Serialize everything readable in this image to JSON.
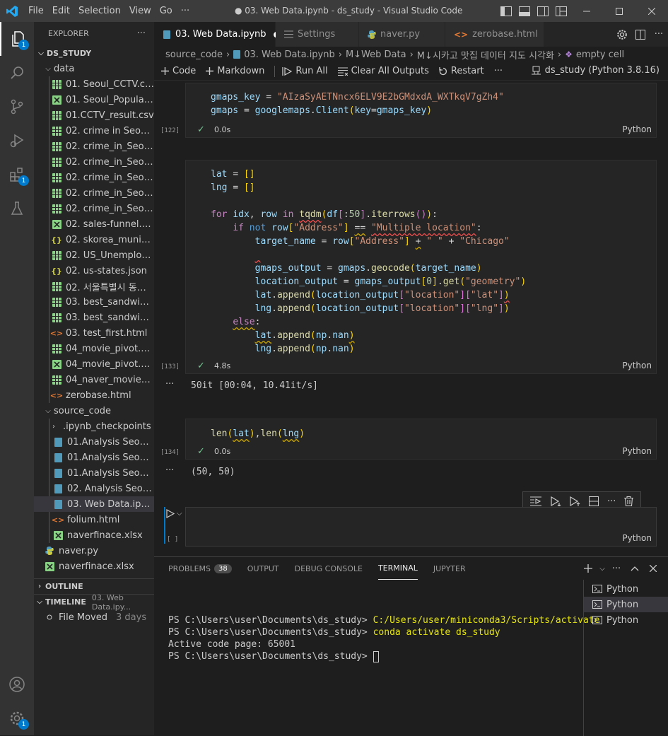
{
  "titlebar": {
    "menu": [
      "File",
      "Edit",
      "Selection",
      "View",
      "Go",
      "···"
    ],
    "title": "● 03. Web Data.ipynb - ds_study - Visual Studio Code"
  },
  "activity": {
    "explorer_badge": "1",
    "extensions_badge": "1",
    "settings_badge": "1"
  },
  "sidebar": {
    "header": "EXPLORER",
    "more": "···",
    "root": "DS_STUDY",
    "data_folder": "data",
    "data_files": [
      {
        "name": "01. Seoul_CCTV.csv",
        "type": "csv"
      },
      {
        "name": "01. Seoul_Populatio...",
        "type": "xlsx"
      },
      {
        "name": "01.CCTV_result.csv",
        "type": "csv"
      },
      {
        "name": "02. crime in Seoul_fi...",
        "type": "csv"
      },
      {
        "name": "02. crime_in_Seoul_1...",
        "type": "csv"
      },
      {
        "name": "02. crime_in_Seoul_fi...",
        "type": "csv"
      },
      {
        "name": "02. crime_in_Seoul_l...",
        "type": "csv"
      },
      {
        "name": "02. crime_in_Seoul_r...",
        "type": "csv"
      },
      {
        "name": "02. crime_in_Seoul.csv",
        "type": "csv"
      },
      {
        "name": "02. sales-funnel.xlsx",
        "type": "xlsx"
      },
      {
        "name": "02. skorea_municipa...",
        "type": "json"
      },
      {
        "name": "02. US_Unemploym...",
        "type": "csv"
      },
      {
        "name": "02. us-states.json",
        "type": "json"
      },
      {
        "name": "02. 서울특별시 동작...",
        "type": "csv"
      },
      {
        "name": "03. best_sandwiches...",
        "type": "csv"
      },
      {
        "name": "03. best_sandwiches...",
        "type": "csv"
      },
      {
        "name": "03. test_first.html",
        "type": "html"
      },
      {
        "name": "04_movie_pivot.csv",
        "type": "csv"
      },
      {
        "name": "04_movie_pivot.xlsx",
        "type": "xlsx"
      },
      {
        "name": "04_naver_movie_raw...",
        "type": "csv"
      },
      {
        "name": "zerobase.html",
        "type": "html"
      }
    ],
    "source_folder": "source_code",
    "source_files": [
      {
        "name": ".ipynb_checkpoints",
        "type": "folder"
      },
      {
        "name": "01.Analysis Seoul CC...",
        "type": "ipynb"
      },
      {
        "name": "01.Analysis Seoul CC...",
        "type": "ipynb"
      },
      {
        "name": "01.Analysis Seoul CC...",
        "type": "ipynb"
      },
      {
        "name": "02. Analysis Seoul Cr...",
        "type": "ipynb"
      },
      {
        "name": "03. Web Data.ipynb",
        "type": "ipynb",
        "selected": true
      },
      {
        "name": "folium.html",
        "type": "html"
      },
      {
        "name": "naverfinace.xlsx",
        "type": "xlsx"
      }
    ],
    "root_files": [
      {
        "name": "naver.py",
        "type": "py"
      },
      {
        "name": "naverfinace.xlsx",
        "type": "xlsx"
      }
    ],
    "outline": "OUTLINE",
    "timeline": "TIMELINE",
    "timeline_file": "03. Web Data.ipy...",
    "timeline_event": "File Moved",
    "timeline_time": "3 days"
  },
  "tabs": [
    {
      "label": "03. Web Data.ipynb",
      "active": true,
      "dirty": "●"
    },
    {
      "label": "Settings"
    },
    {
      "label": "naver.py"
    },
    {
      "label": "zerobase.html"
    }
  ],
  "breadcrumbs": [
    "source_code",
    "03. Web Data.ipynb",
    "M↓Web Data",
    "M↓시카고 맛집 데이터 지도 시각화",
    "empty cell"
  ],
  "toolbar": {
    "code": "Code",
    "markdown": "Markdown",
    "run_all": "Run All",
    "clear": "Clear All Outputs",
    "restart": "Restart",
    "more": "···",
    "kernel": "ds_study (Python 3.8.16)"
  },
  "cells": {
    "c122": {
      "count": "[122]",
      "duration": "0.0s",
      "lang": "Python"
    },
    "c133": {
      "count": "[133]",
      "duration": "4.8s",
      "lang": "Python",
      "output": "50it [00:04, 10.41it/s]"
    },
    "c134": {
      "count": "[134]",
      "duration": "0.0s",
      "lang": "Python",
      "output": "(50, 50)"
    },
    "empty": {
      "count": "[ ]",
      "lang": "Python"
    }
  },
  "output_dots": "···",
  "panel": {
    "tabs": [
      "PROBLEMS",
      "OUTPUT",
      "DEBUG CONSOLE",
      "TERMINAL",
      "JUPYTER"
    ],
    "problems_count": "38",
    "terminal_lines": [
      {
        "prompt": "PS C:\\Users\\user\\Documents\\ds_study> ",
        "cmd": "C:/Users/user/miniconda3/Scripts/activate"
      },
      {
        "prompt": "PS C:\\Users\\user\\Documents\\ds_study> ",
        "cmd": "conda activate ds_study"
      },
      {
        "prompt": "Active code page: 65001",
        "cmd": ""
      },
      {
        "prompt": "PS C:\\Users\\user\\Documents\\ds_study> ",
        "cmd": ""
      }
    ],
    "terminals": [
      "Python",
      "Python",
      "Python"
    ]
  },
  "colors": {
    "accent": "#007acc",
    "csv": "#89d185",
    "xlsx": "#89d185",
    "json": "#cbcb41",
    "html": "#e37933",
    "ipynb": "#519aba",
    "py": "#519aba"
  }
}
